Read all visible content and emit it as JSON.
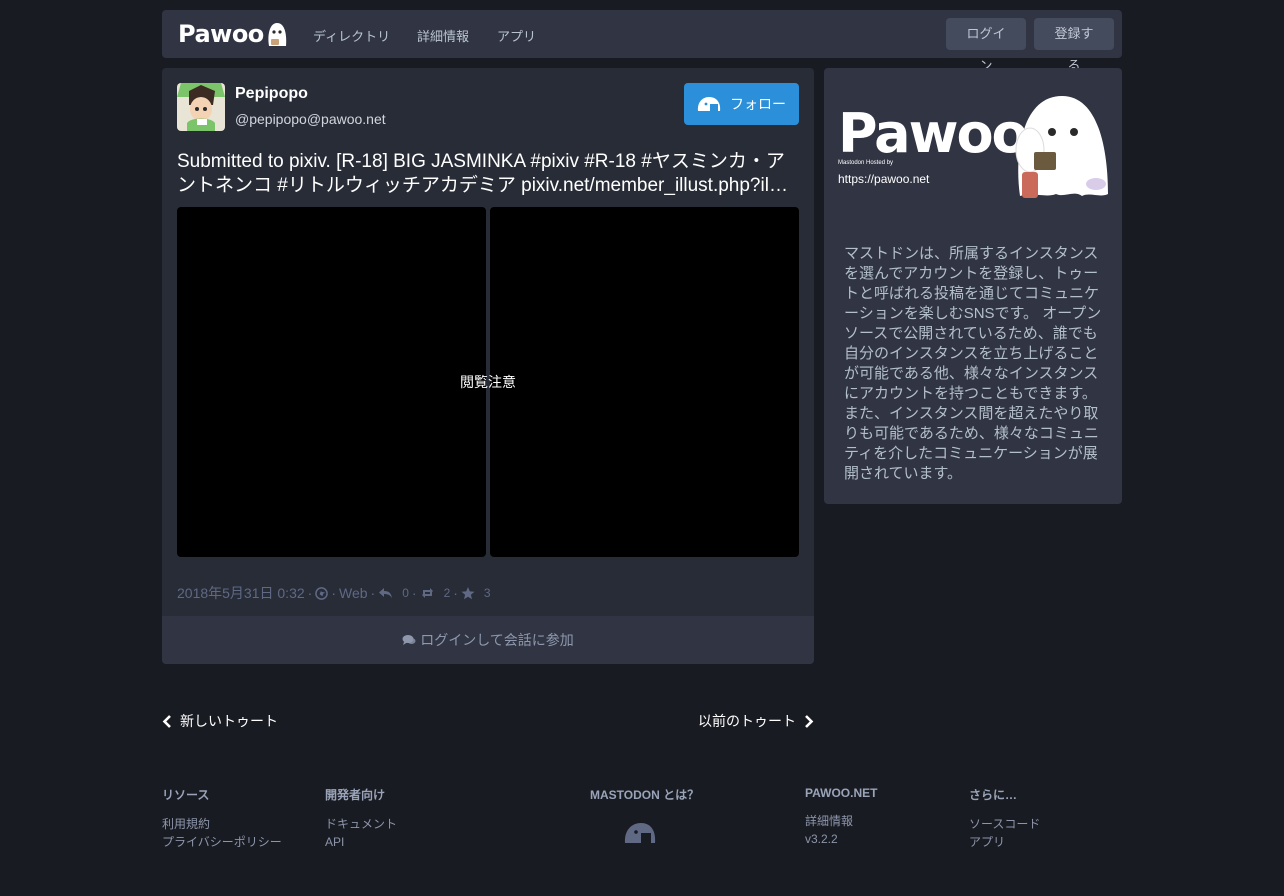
{
  "header": {
    "logo_text": "Pawoo",
    "nav": [
      "ディレクトリ",
      "詳細情報",
      "アプリ"
    ],
    "login_label": "ログイン",
    "signup_label": "登録する"
  },
  "status": {
    "display_name": "Pepipopo",
    "acct": "@pepipopo@pawoo.net",
    "follow_label": "フォロー",
    "content_line1": "Submitted to pixiv. [R-18] BIG JASMINKA #pixiv  #R-18 #ヤスミンカ・ア",
    "content_line2": "ントネンコ #リトルウィッチアカデミア  pixiv.net/member_illust.php?il…",
    "spoiler_label": "閲覧注意",
    "timestamp": "2018年5月31日 0:32",
    "sep": "·",
    "application": "Web",
    "replies": "0",
    "boosts": "2",
    "favourites": "3",
    "join_label": "ログインして会話に参加"
  },
  "sidebar": {
    "hero_url": "https://pawoo.net",
    "hero_sub": "Mastodon Hosted by",
    "description": "マストドンは、所属するインスタンスを選んでアカウントを登録し、トゥートと呼ばれる投稿を通じてコミュニケーションを楽しむSNSです。 オープンソースで公開されているため、誰でも自分のインスタンスを立ち上げることが可能である他、様々なインスタンスにアカウントを持つこともできます。 また、インスタンス間を超えたやり取りも可能であるため、様々なコミュニティを介したコミュニケーションが展開されています。"
  },
  "pager": {
    "newer": "新しいトゥート",
    "older": "以前のトゥート"
  },
  "footer": {
    "resources": {
      "title": "リソース",
      "links": [
        "利用規約",
        "プライバシーポリシー"
      ]
    },
    "developers": {
      "title": "開発者向け",
      "links": [
        "ドキュメント",
        "API"
      ]
    },
    "mastodon": {
      "title": "MASTODON とは？"
    },
    "instance": {
      "title": "PAWOO.NET",
      "links": [
        "詳細情報",
        "v3.2.2"
      ]
    },
    "more": {
      "title": "さらに…",
      "links": [
        "ソースコード",
        "アプリ"
      ]
    }
  },
  "colors": {
    "accent": "#2b90d9",
    "background": "#191b22",
    "card": "#282c37"
  }
}
